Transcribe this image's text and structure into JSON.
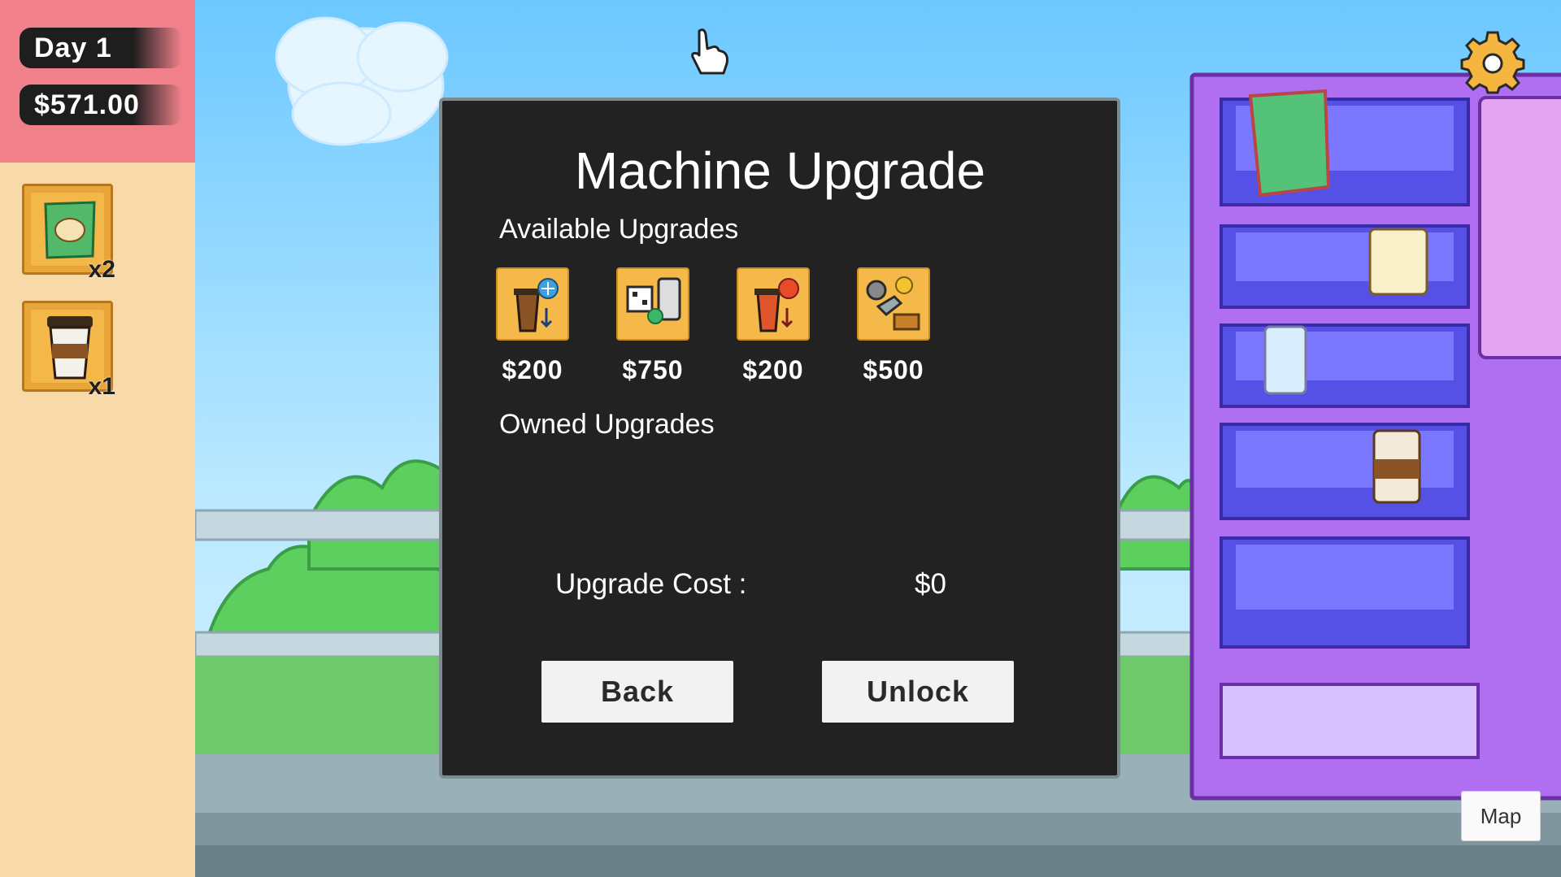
{
  "hud": {
    "day": "Day 1",
    "money": "$571.00"
  },
  "inventory": [
    {
      "name": "chips",
      "count": "x2"
    },
    {
      "name": "coffee",
      "count": "x1"
    }
  ],
  "modal": {
    "title": "Machine Upgrade",
    "available_label": "Available Upgrades",
    "owned_label": "Owned Upgrades",
    "upgrades": [
      {
        "icon": "iced-coffee-icon",
        "price": "$200"
      },
      {
        "icon": "qr-payment-icon",
        "price": "$750"
      },
      {
        "icon": "hot-coffee-icon",
        "price": "$200"
      },
      {
        "icon": "robot-arm-icon",
        "price": "$500"
      }
    ],
    "cost_label": "Upgrade Cost :",
    "cost_value": "$0",
    "back_label": "Back",
    "unlock_label": "Unlock"
  },
  "map_label": "Map",
  "colors": {
    "sky": "#7fd0ff",
    "hud_top": "#f0818a",
    "hud_side": "#f8d9a8",
    "modal_bg": "#222222",
    "vending_machine": "#b06ef0",
    "upgrade_tile": "#f5b94a"
  }
}
